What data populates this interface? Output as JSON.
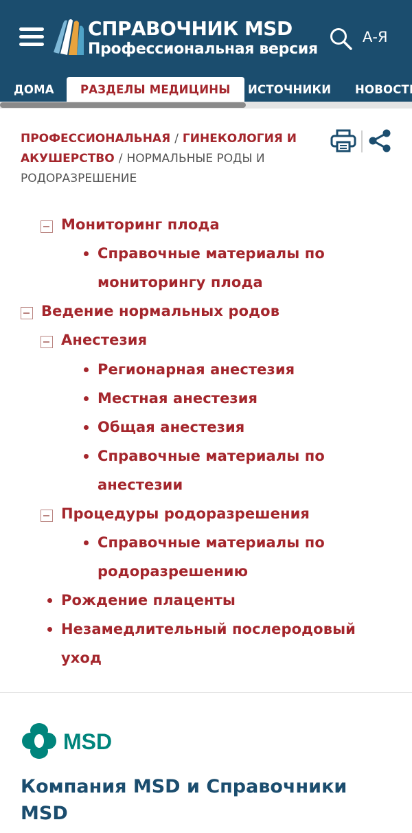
{
  "header": {
    "title": "СПРАВОЧНИК MSD",
    "subtitle": "Профессиональная версия",
    "az_label": "А-Я",
    "bg_color": "#1b4d6e"
  },
  "nav": {
    "tabs": [
      {
        "label": "ДОМА"
      },
      {
        "label": "РАЗДЕЛЫ МЕДИЦИНЫ",
        "active": true
      },
      {
        "label": "ИСТОЧНИКИ"
      },
      {
        "label": "НОВОСТИ"
      }
    ]
  },
  "breadcrumb": {
    "items": [
      "ПРОФЕССИОНАЛЬНАЯ",
      "ГИНЕКОЛОГИЯ И АКУШЕРСТВО"
    ],
    "current": "НОРМАЛЬНЫЕ РОДЫ И РОДОРАЗРЕШЕНИЕ",
    "separator": "/"
  },
  "toolbar": {
    "print_icon": "printer-icon",
    "share_icon": "share-icon"
  },
  "toc": {
    "fetal_monitoring": "Мониторинг плода",
    "fetal_monitoring_refs_1": "Справочные материалы по",
    "fetal_monitoring_refs_2": "мониторингу плода",
    "normal_labor": "Ведение нормальных родов",
    "anesthesia": "Анестезия",
    "regional": "Регионарная анестезия",
    "local": "Местная анестезия",
    "general": "Общая анестезия",
    "anesthesia_refs_1": "Справочные материалы по",
    "anesthesia_refs_2": "анестезии",
    "delivery_procedures": "Процедуры родоразрешения",
    "delivery_refs_1": "Справочные материалы по",
    "delivery_refs_2": "родоразрешению",
    "placenta": "Рождение плаценты",
    "postpartum_1": "Незамедлительный послеродовый",
    "postpartum_2": "уход",
    "link_color": "#a4262c"
  },
  "footer": {
    "logo_text": "MSD",
    "title": "Компания MSD и Справочники MSD",
    "logo_color": "#00857c"
  }
}
